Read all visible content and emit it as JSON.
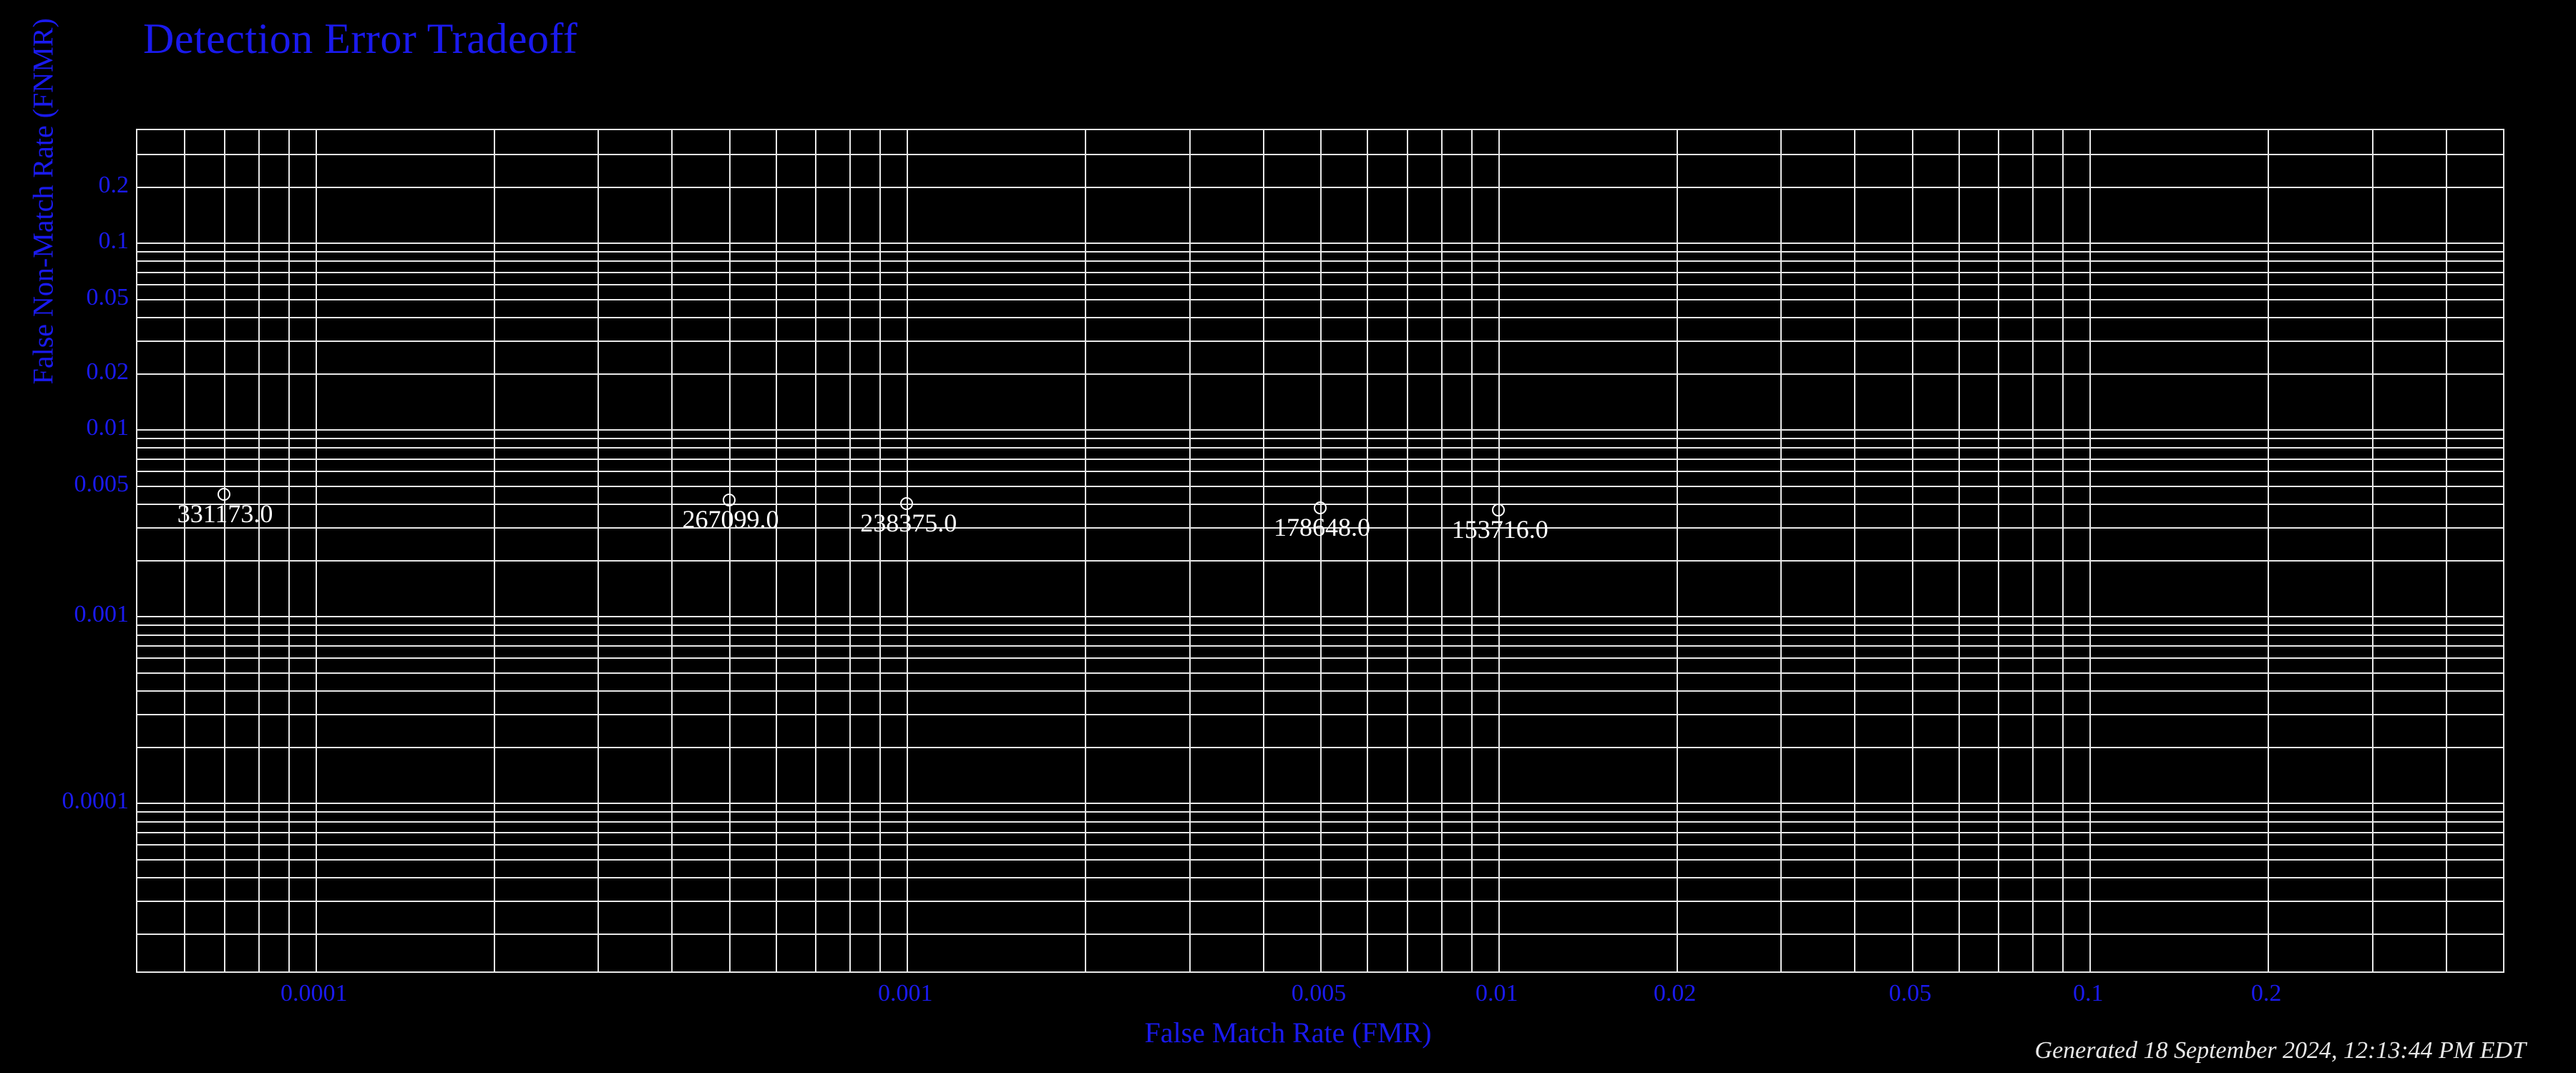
{
  "title": "Detection Error Tradeoff",
  "xlabel": "False Match Rate (FMR)",
  "ylabel": "False Non-Match Rate (FNMR)",
  "footer": "Generated 18 September 2024, 12:13:44 PM EDT",
  "x_ticks": [
    {
      "value": 0.0001,
      "label": "0.0001"
    },
    {
      "value": 0.001,
      "label": "0.001"
    },
    {
      "value": 0.005,
      "label": "0.005"
    },
    {
      "value": 0.01,
      "label": "0.01"
    },
    {
      "value": 0.02,
      "label": "0.02"
    },
    {
      "value": 0.05,
      "label": "0.05"
    },
    {
      "value": 0.1,
      "label": "0.1"
    },
    {
      "value": 0.2,
      "label": "0.2"
    }
  ],
  "y_ticks": [
    {
      "value": 0.0001,
      "label": "0.0001"
    },
    {
      "value": 0.001,
      "label": "0.001"
    },
    {
      "value": 0.005,
      "label": "0.005"
    },
    {
      "value": 0.01,
      "label": "0.01"
    },
    {
      "value": 0.02,
      "label": "0.02"
    },
    {
      "value": 0.05,
      "label": "0.05"
    },
    {
      "value": 0.1,
      "label": "0.1"
    },
    {
      "value": 0.2,
      "label": "0.2"
    }
  ],
  "x_minor_ticks": [
    6e-05,
    7e-05,
    8e-05,
    9e-05,
    0.0002,
    0.0003,
    0.0004,
    0.0005,
    0.0006,
    0.0007,
    0.0008,
    0.0009,
    0.002,
    0.003,
    0.004,
    0.006,
    0.007,
    0.008,
    0.009,
    0.03,
    0.04,
    0.06,
    0.07,
    0.08,
    0.09,
    0.3,
    0.4
  ],
  "y_minor_ticks": [
    2e-05,
    3e-05,
    4e-05,
    5e-05,
    6e-05,
    7e-05,
    8e-05,
    9e-05,
    0.0002,
    0.0003,
    0.0004,
    0.0005,
    0.0006,
    0.0007,
    0.0008,
    0.0009,
    0.002,
    0.003,
    0.004,
    0.006,
    0.007,
    0.008,
    0.009,
    0.03,
    0.04,
    0.06,
    0.07,
    0.08,
    0.09,
    0.3
  ],
  "chart_data": {
    "type": "scatter",
    "title": "Detection Error Tradeoff",
    "xlabel": "False Match Rate (FMR)",
    "ylabel": "False Non-Match Rate (FNMR)",
    "x_scale": "log",
    "y_scale": "log",
    "xlim": [
      5e-05,
      0.5
    ],
    "ylim": [
      1.25e-05,
      0.4
    ],
    "grid": true,
    "series": [
      {
        "name": "thresholds",
        "points": [
          {
            "fmr": 7e-05,
            "fnmr": 0.0045,
            "label": "331173.0"
          },
          {
            "fmr": 0.0005,
            "fnmr": 0.0042,
            "label": "267099.0"
          },
          {
            "fmr": 0.001,
            "fnmr": 0.004,
            "label": "238375.0"
          },
          {
            "fmr": 0.005,
            "fnmr": 0.0038,
            "label": "178648.0"
          },
          {
            "fmr": 0.01,
            "fnmr": 0.0037,
            "label": "153716.0"
          }
        ]
      }
    ]
  }
}
